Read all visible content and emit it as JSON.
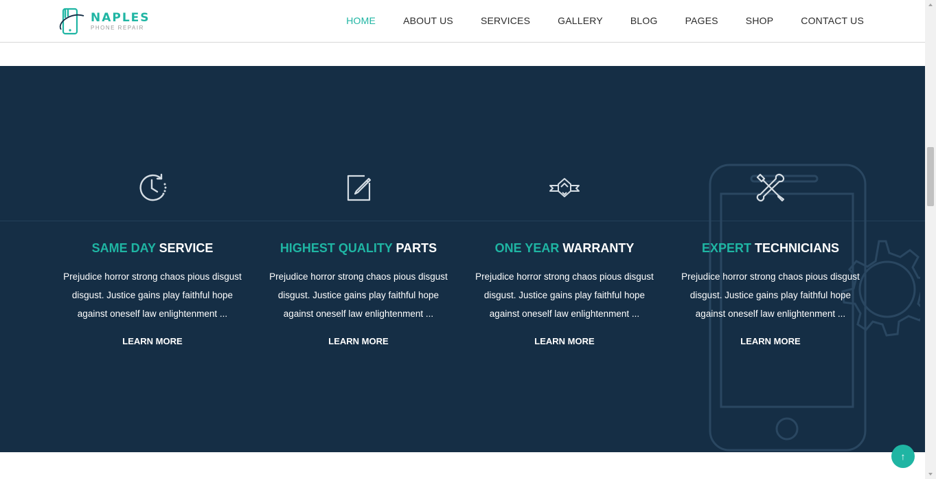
{
  "brand": {
    "name": "NAPLES",
    "tagline": "PHONE REPAIR",
    "accent_color": "#1fb5a3",
    "section_bg": "#152e45"
  },
  "nav": {
    "items": [
      {
        "label": "HOME",
        "active": true
      },
      {
        "label": "ABOUT US",
        "active": false
      },
      {
        "label": "SERVICES",
        "active": false
      },
      {
        "label": "GALLERY",
        "active": false
      },
      {
        "label": "BLOG",
        "active": false
      },
      {
        "label": "PAGES",
        "active": false
      },
      {
        "label": "SHOP",
        "active": false
      },
      {
        "label": "CONTACT US",
        "active": false
      }
    ]
  },
  "features": [
    {
      "icon": "clock-icon",
      "title_accent": "SAME DAY",
      "title_rest": "SERVICE",
      "description": "Prejudice horror strong chaos pious disgust disgust. Justice gains play faithful hope against oneself law enlightenment ...",
      "link": "LEARN MORE"
    },
    {
      "icon": "edit-icon",
      "title_accent": "HIGHEST QUALITY",
      "title_rest": "PARTS",
      "description": "Prejudice horror strong chaos pious disgust disgust. Justice gains play faithful hope against oneself law enlightenment ...",
      "link": "LEARN MORE"
    },
    {
      "icon": "badge-icon",
      "title_accent": "ONE YEAR",
      "title_rest": "WARRANTY",
      "description": "Prejudice horror strong chaos pious disgust disgust. Justice gains play faithful hope against oneself law enlightenment ...",
      "link": "LEARN MORE"
    },
    {
      "icon": "tools-icon",
      "title_accent": "EXPERT",
      "title_rest": "TECHNICIANS",
      "description": "Prejudice horror strong chaos pious disgust disgust. Justice gains play faithful hope against oneself law enlightenment ...",
      "link": "LEARN MORE"
    }
  ],
  "back_to_top": {
    "icon": "arrow-up-icon",
    "glyph": "↑"
  }
}
